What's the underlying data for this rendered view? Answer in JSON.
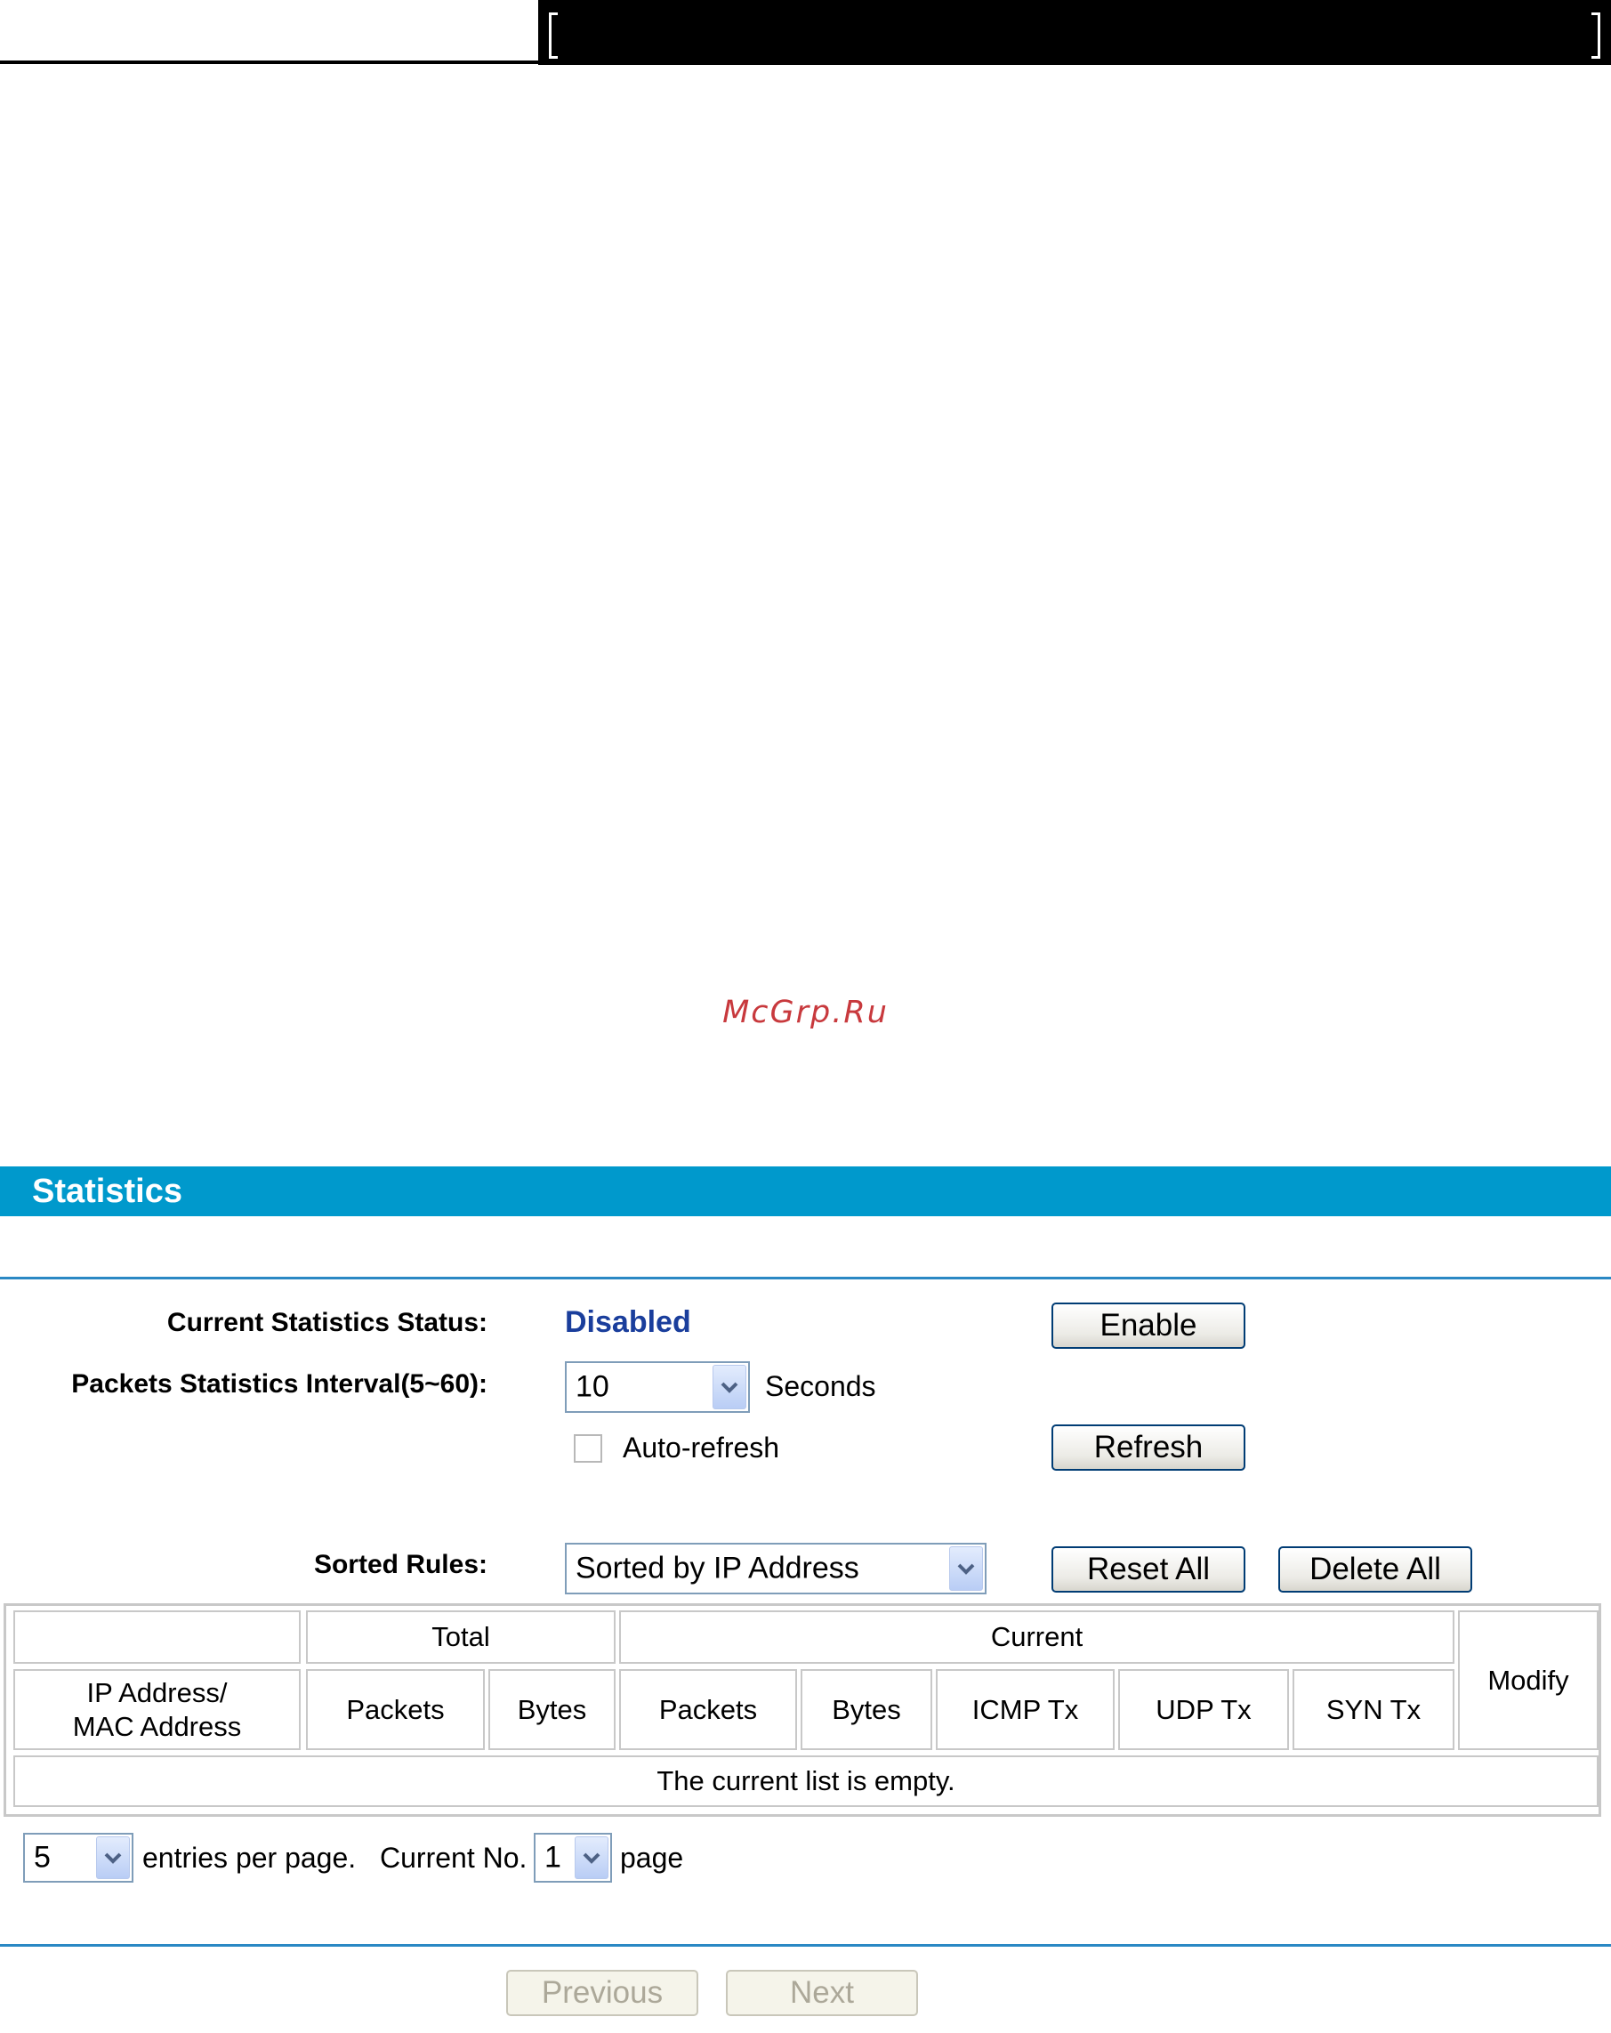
{
  "watermark": "McGrp.Ru",
  "statistics": {
    "title": "Statistics",
    "status_label": "Current Statistics Status:",
    "status_value": "Disabled",
    "status_color": "#1a3e9c",
    "enable_button": "Enable",
    "interval_label": "Packets Statistics Interval(5~60):",
    "interval_value": "10",
    "interval_unit": "Seconds",
    "auto_refresh_label": "Auto-refresh",
    "auto_refresh_checked": false,
    "refresh_button": "Refresh",
    "sorted_rules_label": "Sorted Rules:",
    "sorted_rules_value": "Sorted by IP Address",
    "reset_all_button": "Reset All",
    "delete_all_button": "Delete All"
  },
  "table": {
    "group_headers": {
      "total": "Total",
      "current": "Current",
      "modify": "Modify"
    },
    "columns": {
      "address_line1": "IP Address/",
      "address_line2": "MAC Address",
      "total_packets": "Packets",
      "total_bytes": "Bytes",
      "current_packets": "Packets",
      "current_bytes": "Bytes",
      "icmp_tx": "ICMP Tx",
      "udp_tx": "UDP Tx",
      "syn_tx": "SYN Tx"
    },
    "empty_message": "The current list is empty."
  },
  "pagination": {
    "entries_value": "5",
    "entries_label": "entries per page.",
    "current_no_label": "Current No.",
    "page_value": "1",
    "page_label": "page",
    "previous_button": "Previous",
    "next_button": "Next"
  },
  "colors": {
    "header_bar": "#0099cc",
    "divider": "#2a88c4"
  }
}
